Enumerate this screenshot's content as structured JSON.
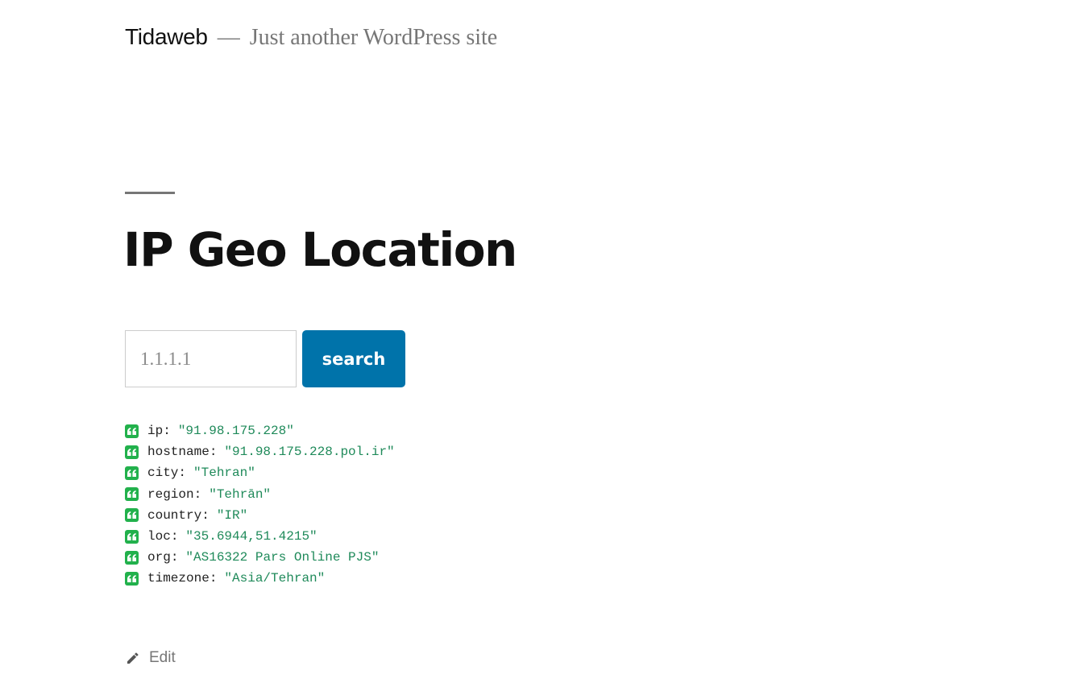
{
  "site": {
    "title": "Tidaweb",
    "separator": "—",
    "description": "Just another WordPress site"
  },
  "page": {
    "title": "IP Geo Location"
  },
  "search": {
    "placeholder": "1.1.1.1",
    "value": "",
    "button_label": "search"
  },
  "results": [
    {
      "key": "ip",
      "value": "\"91.98.175.228\""
    },
    {
      "key": "hostname",
      "value": "\"91.98.175.228.pol.ir\""
    },
    {
      "key": "city",
      "value": "\"Tehran\""
    },
    {
      "key": "region",
      "value": "\"Tehrān\""
    },
    {
      "key": "country",
      "value": "\"IR\""
    },
    {
      "key": "loc",
      "value": "\"35.6944,51.4215\""
    },
    {
      "key": "org",
      "value": "\"AS16322 Pars Online PJS\""
    },
    {
      "key": "timezone",
      "value": "\"Asia/Tehran\""
    }
  ],
  "footer": {
    "edit_label": "Edit"
  },
  "colors": {
    "button_bg": "#0073aa",
    "quote_icon_bg": "#22b14c",
    "result_value": "#1f8a5a",
    "muted_text": "#767676"
  },
  "icons": {
    "result_row": "quote-icon",
    "edit": "pencil-icon"
  }
}
